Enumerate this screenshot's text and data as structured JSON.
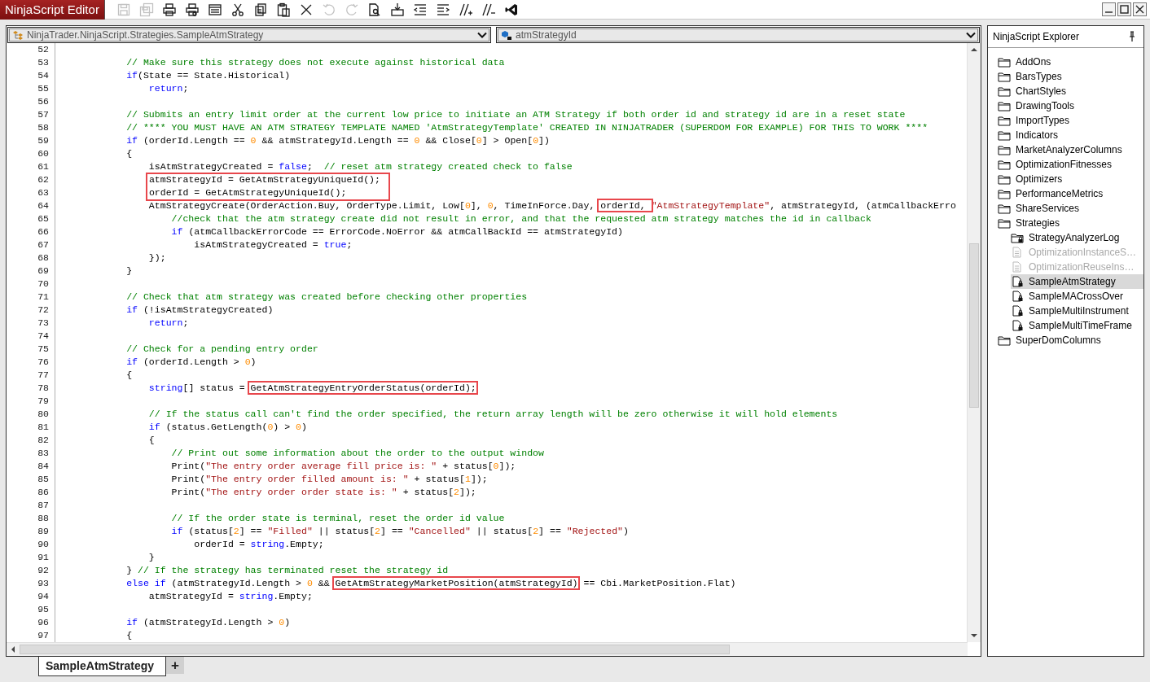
{
  "title_bar": {
    "title": "NinjaScript Editor"
  },
  "toolbar": [
    {
      "kind": "save",
      "disabled": true
    },
    {
      "kind": "save-all",
      "disabled": true
    },
    {
      "kind": "print",
      "disabled": false
    },
    {
      "kind": "print-preview",
      "disabled": false
    },
    {
      "kind": "window",
      "disabled": false
    },
    {
      "kind": "cut",
      "disabled": false
    },
    {
      "kind": "copy",
      "disabled": false
    },
    {
      "kind": "paste",
      "disabled": false
    },
    {
      "kind": "delete",
      "disabled": false
    },
    {
      "kind": "undo",
      "disabled": true
    },
    {
      "kind": "redo",
      "disabled": true
    },
    {
      "kind": "document-search",
      "disabled": false
    },
    {
      "kind": "download",
      "disabled": false
    },
    {
      "kind": "outdent",
      "disabled": false
    },
    {
      "kind": "indent",
      "disabled": false
    },
    {
      "kind": "comment",
      "disabled": false
    },
    {
      "kind": "uncomment",
      "disabled": false
    },
    {
      "kind": "logo",
      "disabled": false
    }
  ],
  "window_controls": [
    {
      "kind": "minimize"
    },
    {
      "kind": "maximize"
    },
    {
      "kind": "close"
    }
  ],
  "editor": {
    "class_dropdown": "NinjaTrader.NinjaScript.Strategies.SampleAtmStrategy",
    "member_dropdown": "atmStrategyId",
    "lines": [
      {
        "number": "52"
      },
      {
        "number": "53",
        "tokens": [
          {
            "kind": "comment",
            "text": "            // Make sure this strategy does not execute against historical data"
          }
        ]
      },
      {
        "number": "54",
        "tokens": [
          {
            "kind": "keyword",
            "text": "            if"
          },
          {
            "kind": "plain",
            "text": "(State == State.Historical)"
          }
        ]
      },
      {
        "number": "55",
        "tokens": [
          {
            "kind": "keyword",
            "text": "                return"
          },
          {
            "kind": "plain",
            "text": ";"
          }
        ]
      },
      {
        "number": "56"
      },
      {
        "number": "57",
        "tokens": [
          {
            "kind": "comment",
            "text": "            // Submits an entry limit order at the current low price to initiate an ATM Strategy if both order id and strategy id are in a reset state"
          }
        ]
      },
      {
        "number": "58",
        "tokens": [
          {
            "kind": "comment",
            "text": "            // **** YOU MUST HAVE AN ATM STRATEGY TEMPLATE NAMED 'AtmStrategyTemplate' CREATED IN NINJATRADER (SUPERDOM FOR EXAMPLE) FOR THIS TO WORK ****"
          }
        ]
      },
      {
        "number": "59",
        "tokens": [
          {
            "kind": "keyword",
            "text": "            if"
          },
          {
            "kind": "plain",
            "text": " (orderId.Length == "
          },
          {
            "kind": "number",
            "text": "0"
          },
          {
            "kind": "plain",
            "text": " && atmStrategyId.Length == "
          },
          {
            "kind": "number",
            "text": "0"
          },
          {
            "kind": "plain",
            "text": " && Close["
          },
          {
            "kind": "number",
            "text": "0"
          },
          {
            "kind": "plain",
            "text": "] > Open["
          },
          {
            "kind": "number",
            "text": "0"
          },
          {
            "kind": "plain",
            "text": "])"
          }
        ]
      },
      {
        "number": "60",
        "tokens": [
          {
            "kind": "plain",
            "text": "            {"
          }
        ]
      },
      {
        "number": "61",
        "tokens": [
          {
            "kind": "plain",
            "text": "                isAtmStrategyCreated = "
          },
          {
            "kind": "keyword",
            "text": "false"
          },
          {
            "kind": "plain",
            "text": ";  "
          },
          {
            "kind": "comment",
            "text": "// reset atm strategy created check to false"
          }
        ]
      },
      {
        "number": "62",
        "tokens": [
          {
            "kind": "plain",
            "text": "                atmStrategyId = GetAtmStrategyUniqueId();",
            "highlighted": true,
            "continues_below": true
          }
        ]
      },
      {
        "number": "63",
        "tokens": [
          {
            "kind": "plain",
            "text": "                orderId = GetAtmStrategyUniqueId();",
            "highlighted": true,
            "continues_above": true
          }
        ]
      },
      {
        "number": "64",
        "tokens": [
          {
            "kind": "plain",
            "text": "                AtmStrategyCreate(OrderAction.Buy, OrderType.Limit, Low["
          },
          {
            "kind": "number",
            "text": "0"
          },
          {
            "kind": "plain",
            "text": "], "
          },
          {
            "kind": "number",
            "text": "0"
          },
          {
            "kind": "plain",
            "text": ", TimeInForce.Day, "
          },
          {
            "kind": "plain",
            "text": "orderId, ",
            "highlighted": true
          },
          {
            "kind": "string",
            "text": "\"AtmStrategyTemplate\""
          },
          {
            "kind": "plain",
            "text": ", atmStrategyId, (atmCallbackErro"
          }
        ]
      },
      {
        "number": "65",
        "tokens": [
          {
            "kind": "comment",
            "text": "                    //check that the atm strategy create did not result in error, and that the requested atm strategy matches the id in callback"
          }
        ]
      },
      {
        "number": "66",
        "tokens": [
          {
            "kind": "keyword",
            "text": "                    if"
          },
          {
            "kind": "plain",
            "text": " (atmCallbackErrorCode == ErrorCode.NoError && atmCallBackId == atmStrategyId)"
          }
        ]
      },
      {
        "number": "67",
        "tokens": [
          {
            "kind": "plain",
            "text": "                        isAtmStrategyCreated = "
          },
          {
            "kind": "keyword",
            "text": "true"
          },
          {
            "kind": "plain",
            "text": ";"
          }
        ]
      },
      {
        "number": "68",
        "tokens": [
          {
            "kind": "plain",
            "text": "                });"
          }
        ]
      },
      {
        "number": "69",
        "tokens": [
          {
            "kind": "plain",
            "text": "            }"
          }
        ]
      },
      {
        "number": "70"
      },
      {
        "number": "71",
        "tokens": [
          {
            "kind": "comment",
            "text": "            // Check that atm strategy was created before checking other properties"
          }
        ]
      },
      {
        "number": "72",
        "tokens": [
          {
            "kind": "keyword",
            "text": "            if"
          },
          {
            "kind": "plain",
            "text": " (!isAtmStrategyCreated)"
          }
        ]
      },
      {
        "number": "73",
        "tokens": [
          {
            "kind": "keyword",
            "text": "                return"
          },
          {
            "kind": "plain",
            "text": ";"
          }
        ]
      },
      {
        "number": "74"
      },
      {
        "number": "75",
        "tokens": [
          {
            "kind": "comment",
            "text": "            // Check for a pending entry order"
          }
        ]
      },
      {
        "number": "76",
        "tokens": [
          {
            "kind": "keyword",
            "text": "            if"
          },
          {
            "kind": "plain",
            "text": " (orderId.Length > "
          },
          {
            "kind": "number",
            "text": "0"
          },
          {
            "kind": "plain",
            "text": ")"
          }
        ]
      },
      {
        "number": "77",
        "tokens": [
          {
            "kind": "plain",
            "text": "            {"
          }
        ]
      },
      {
        "number": "78",
        "tokens": [
          {
            "kind": "keyword",
            "text": "                string"
          },
          {
            "kind": "plain",
            "text": "[] status = "
          },
          {
            "kind": "plain",
            "text": "GetAtmStrategyEntryOrderStatus(orderId);",
            "highlighted": true
          }
        ]
      },
      {
        "number": "79"
      },
      {
        "number": "80",
        "tokens": [
          {
            "kind": "comment",
            "text": "                // If the status call can't find the order specified, the return array length will be zero otherwise it will hold elements"
          }
        ]
      },
      {
        "number": "81",
        "tokens": [
          {
            "kind": "keyword",
            "text": "                if"
          },
          {
            "kind": "plain",
            "text": " (status.GetLength("
          },
          {
            "kind": "number",
            "text": "0"
          },
          {
            "kind": "plain",
            "text": ") > "
          },
          {
            "kind": "number",
            "text": "0"
          },
          {
            "kind": "plain",
            "text": ")"
          }
        ]
      },
      {
        "number": "82",
        "tokens": [
          {
            "kind": "plain",
            "text": "                {"
          }
        ]
      },
      {
        "number": "83",
        "tokens": [
          {
            "kind": "comment",
            "text": "                    // Print out some information about the order to the output window"
          }
        ]
      },
      {
        "number": "84",
        "tokens": [
          {
            "kind": "plain",
            "text": "                    Print("
          },
          {
            "kind": "string",
            "text": "\"The entry order average fill price is: \""
          },
          {
            "kind": "plain",
            "text": " + status["
          },
          {
            "kind": "number",
            "text": "0"
          },
          {
            "kind": "plain",
            "text": "]);"
          }
        ]
      },
      {
        "number": "85",
        "tokens": [
          {
            "kind": "plain",
            "text": "                    Print("
          },
          {
            "kind": "string",
            "text": "\"The entry order filled amount is: \""
          },
          {
            "kind": "plain",
            "text": " + status["
          },
          {
            "kind": "number",
            "text": "1"
          },
          {
            "kind": "plain",
            "text": "]);"
          }
        ]
      },
      {
        "number": "86",
        "tokens": [
          {
            "kind": "plain",
            "text": "                    Print("
          },
          {
            "kind": "string",
            "text": "\"The entry order order state is: \""
          },
          {
            "kind": "plain",
            "text": " + status["
          },
          {
            "kind": "number",
            "text": "2"
          },
          {
            "kind": "plain",
            "text": "]);"
          }
        ]
      },
      {
        "number": "87"
      },
      {
        "number": "88",
        "tokens": [
          {
            "kind": "comment",
            "text": "                    // If the order state is terminal, reset the order id value"
          }
        ]
      },
      {
        "number": "89",
        "tokens": [
          {
            "kind": "keyword",
            "text": "                    if"
          },
          {
            "kind": "plain",
            "text": " (status["
          },
          {
            "kind": "number",
            "text": "2"
          },
          {
            "kind": "plain",
            "text": "] == "
          },
          {
            "kind": "string",
            "text": "\"Filled\""
          },
          {
            "kind": "plain",
            "text": " || status["
          },
          {
            "kind": "number",
            "text": "2"
          },
          {
            "kind": "plain",
            "text": "] == "
          },
          {
            "kind": "string",
            "text": "\"Cancelled\""
          },
          {
            "kind": "plain",
            "text": " || status["
          },
          {
            "kind": "number",
            "text": "2"
          },
          {
            "kind": "plain",
            "text": "] == "
          },
          {
            "kind": "string",
            "text": "\"Rejected\""
          },
          {
            "kind": "plain",
            "text": ")"
          }
        ]
      },
      {
        "number": "90",
        "tokens": [
          {
            "kind": "plain",
            "text": "                        orderId = "
          },
          {
            "kind": "keyword",
            "text": "string"
          },
          {
            "kind": "plain",
            "text": ".Empty;"
          }
        ]
      },
      {
        "number": "91",
        "tokens": [
          {
            "kind": "plain",
            "text": "                }"
          }
        ]
      },
      {
        "number": "92",
        "tokens": [
          {
            "kind": "plain",
            "text": "            } "
          },
          {
            "kind": "comment",
            "text": "// If the strategy has terminated reset the strategy id"
          }
        ]
      },
      {
        "number": "93",
        "tokens": [
          {
            "kind": "keyword",
            "text": "            else"
          },
          {
            "kind": "keyword",
            "text": " if"
          },
          {
            "kind": "plain",
            "text": " (atmStrategyId.Length > "
          },
          {
            "kind": "number",
            "text": "0"
          },
          {
            "kind": "plain",
            "text": " && "
          },
          {
            "kind": "plain",
            "text": "GetAtmStrategyMarketPosition(atmStrategyId)",
            "highlighted": true
          },
          {
            "kind": "plain",
            "text": " == Cbi.MarketPosition.Flat)"
          }
        ]
      },
      {
        "number": "94",
        "tokens": [
          {
            "kind": "plain",
            "text": "                atmStrategyId = "
          },
          {
            "kind": "keyword",
            "text": "string"
          },
          {
            "kind": "plain",
            "text": ".Empty;"
          }
        ]
      },
      {
        "number": "95"
      },
      {
        "number": "96",
        "tokens": [
          {
            "kind": "keyword",
            "text": "            if"
          },
          {
            "kind": "plain",
            "text": " (atmStrategyId.Length > "
          },
          {
            "kind": "number",
            "text": "0"
          },
          {
            "kind": "plain",
            "text": ")"
          }
        ]
      },
      {
        "number": "97",
        "tokens": [
          {
            "kind": "plain",
            "text": "            {"
          }
        ]
      }
    ]
  },
  "explorer": {
    "title": "NinjaScript Explorer",
    "items": [
      {
        "label": "AddOns",
        "kind": "folder",
        "selected": false,
        "disabled": false,
        "locked": false
      },
      {
        "label": "BarsTypes",
        "kind": "folder",
        "selected": false,
        "disabled": false,
        "locked": false
      },
      {
        "label": "ChartStyles",
        "kind": "folder",
        "selected": false,
        "disabled": false,
        "locked": false
      },
      {
        "label": "DrawingTools",
        "kind": "folder",
        "selected": false,
        "disabled": false,
        "locked": false
      },
      {
        "label": "ImportTypes",
        "kind": "folder",
        "selected": false,
        "disabled": false,
        "locked": false
      },
      {
        "label": "Indicators",
        "kind": "folder",
        "selected": false,
        "disabled": false,
        "locked": false
      },
      {
        "label": "MarketAnalyzerColumns",
        "kind": "folder",
        "selected": false,
        "disabled": false,
        "locked": false
      },
      {
        "label": "OptimizationFitnesses",
        "kind": "folder",
        "selected": false,
        "disabled": false,
        "locked": false
      },
      {
        "label": "Optimizers",
        "kind": "folder",
        "selected": false,
        "disabled": false,
        "locked": false
      },
      {
        "label": "PerformanceMetrics",
        "kind": "folder",
        "selected": false,
        "disabled": false,
        "locked": false
      },
      {
        "label": "ShareServices",
        "kind": "folder",
        "selected": false,
        "disabled": false,
        "locked": false
      },
      {
        "label": "Strategies",
        "kind": "folder",
        "selected": false,
        "disabled": false,
        "locked": false,
        "children": [
          {
            "label": "StrategyAnalyzerLog",
            "kind": "folder",
            "selected": false,
            "disabled": false,
            "locked": true
          },
          {
            "label": "OptimizationInstanceS…",
            "kind": "file",
            "selected": false,
            "disabled": true,
            "locked": false
          },
          {
            "label": "OptimizationReuseIns…",
            "kind": "file",
            "selected": false,
            "disabled": true,
            "locked": false
          },
          {
            "label": "SampleAtmStrategy",
            "kind": "file",
            "selected": true,
            "disabled": false,
            "locked": true
          },
          {
            "label": "SampleMACrossOver",
            "kind": "file",
            "selected": false,
            "disabled": false,
            "locked": true
          },
          {
            "label": "SampleMultiInstrument",
            "kind": "file",
            "selected": false,
            "disabled": false,
            "locked": true
          },
          {
            "label": "SampleMultiTimeFrame",
            "kind": "file",
            "selected": false,
            "disabled": false,
            "locked": true
          }
        ]
      },
      {
        "label": "SuperDomColumns",
        "kind": "folder",
        "selected": false,
        "disabled": false,
        "locked": false
      }
    ]
  },
  "tabs": [
    {
      "label": "SampleAtmStrategy",
      "selected": true
    }
  ],
  "add_tab": "+"
}
